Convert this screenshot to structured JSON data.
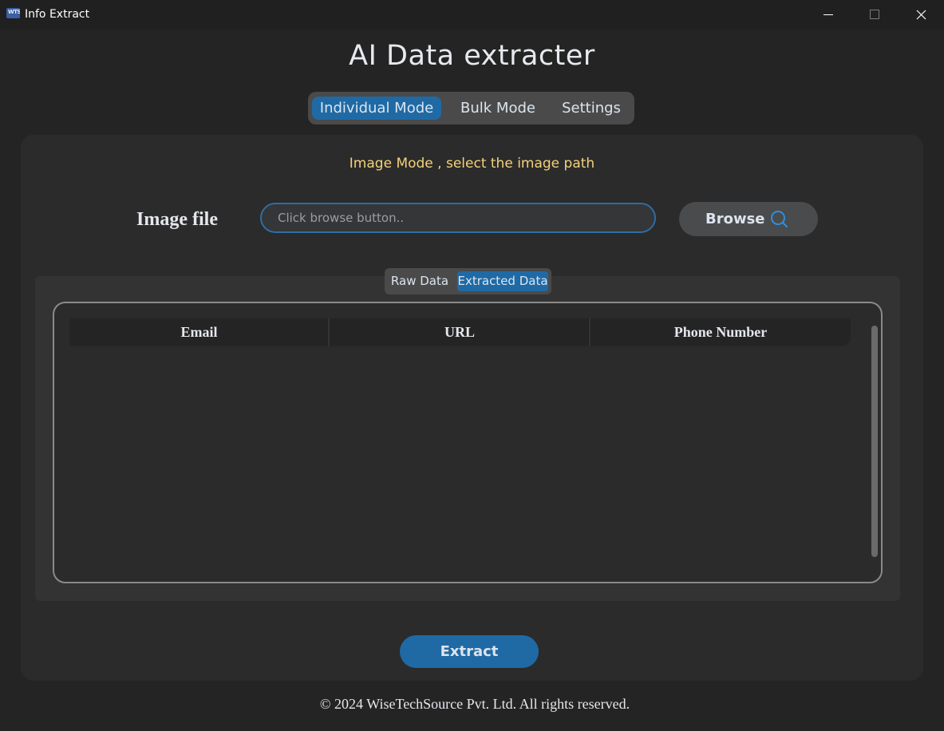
{
  "window": {
    "title": "Info Extract",
    "icon_text": "WTS",
    "controls": [
      "minimize-icon",
      "maximize-icon",
      "close-icon"
    ]
  },
  "header": {
    "title": "AI Data extracter",
    "mode_tabs": [
      {
        "label": "Individual Mode",
        "active": true
      },
      {
        "label": "Bulk Mode",
        "active": false
      },
      {
        "label": "Settings",
        "active": false
      }
    ]
  },
  "main": {
    "hint": "Image Mode , select the image path",
    "image_file_label": "Image file",
    "path_input": {
      "value": "",
      "placeholder": "Click browse button.."
    },
    "browse": {
      "label": "Browse",
      "icon": "search-icon"
    },
    "data_tabs": [
      {
        "label": "Raw Data",
        "active": false
      },
      {
        "label": "Extracted Data",
        "active": true
      }
    ],
    "table": {
      "columns": [
        "Email",
        "URL",
        "Phone Number"
      ],
      "rows": []
    },
    "extract_label": "Extract"
  },
  "footer": {
    "text": "© 2024 WiseTechSource Pvt. Ltd. All rights reserved."
  },
  "colors": {
    "accent": "#1f6aa5",
    "hint": "#f4d27a",
    "background": "#242424",
    "panel": "#2b2b2b"
  }
}
